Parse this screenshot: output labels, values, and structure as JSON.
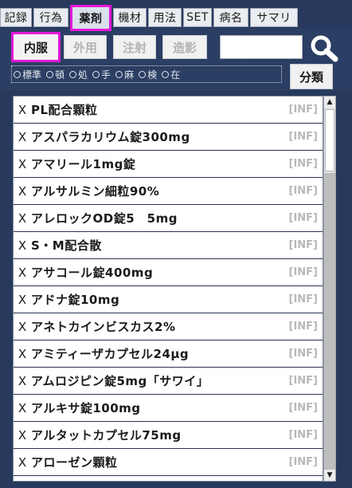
{
  "tabs": [
    {
      "label": "記録"
    },
    {
      "label": "行為"
    },
    {
      "label": "薬剤"
    },
    {
      "label": "機材"
    },
    {
      "label": "用法"
    },
    {
      "label": "SET"
    },
    {
      "label": "病名"
    },
    {
      "label": "サマリ"
    }
  ],
  "active_tab": "薬剤",
  "route_buttons": [
    {
      "label": "内服"
    },
    {
      "label": "外用"
    },
    {
      "label": "注射"
    },
    {
      "label": "造影"
    }
  ],
  "active_route": "内服",
  "search": {
    "value": "",
    "placeholder": ""
  },
  "radios": [
    {
      "label": "標準"
    },
    {
      "label": "頓"
    },
    {
      "label": "処"
    },
    {
      "label": "手"
    },
    {
      "label": "麻"
    },
    {
      "label": "検"
    },
    {
      "label": "在"
    }
  ],
  "classify_label": "分類",
  "remove_glyph": "X",
  "drugs": [
    {
      "name": "PL配合顆粒",
      "tag": "[INF]"
    },
    {
      "name": "アスパラカリウム錠300mg",
      "tag": "[INF]"
    },
    {
      "name": "アマリール1mg錠",
      "tag": "[INF]"
    },
    {
      "name": "アルサルミン細粒90%",
      "tag": "[INF]"
    },
    {
      "name": "アレロックOD錠5　5mg",
      "tag": "[INF]"
    },
    {
      "name": "S・M配合散",
      "tag": "[INF]"
    },
    {
      "name": "アサコール錠400mg",
      "tag": "[INF]"
    },
    {
      "name": "アドナ錠10mg",
      "tag": "[INF]"
    },
    {
      "name": "アネトカインビスカス2%",
      "tag": "[INF]"
    },
    {
      "name": "アミティーザカプセル24μg",
      "tag": "[INF]"
    },
    {
      "name": "アムロジピン錠5mg「サワイ」",
      "tag": "[INF]"
    },
    {
      "name": "アルキサ錠100mg",
      "tag": "[INF]"
    },
    {
      "name": "アルタットカプセル75mg",
      "tag": "[INF]"
    },
    {
      "name": "アローゼン顆粒",
      "tag": "[INF]"
    }
  ],
  "colors": {
    "background": "#273a5d",
    "highlight": "#e316d8",
    "tab": "#e9ecf0"
  }
}
